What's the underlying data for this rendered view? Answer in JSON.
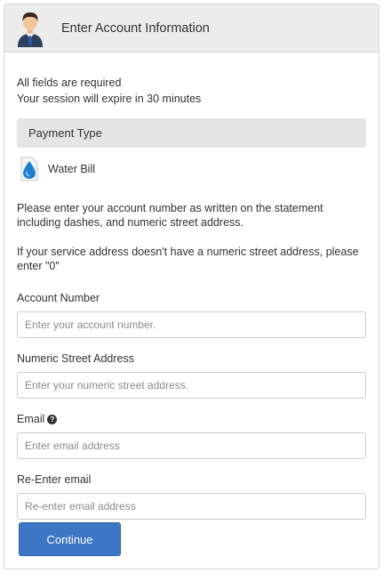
{
  "header": {
    "title": "Enter Account Information",
    "avatar_icon": "user-icon"
  },
  "notes": {
    "required": "All fields are required",
    "session": "Your session will expire in 30 minutes"
  },
  "payment": {
    "section_title": "Payment Type",
    "option_label": "Water Bill",
    "option_icon": "water-drop-icon"
  },
  "instructions": {
    "account": "Please enter your account number as written on the statement including dashes, and numeric street address.",
    "address": "If your service address doesn't have a numeric street address, please enter \"0\""
  },
  "fields": {
    "account_number": {
      "label": "Account Number",
      "placeholder": "Enter your account number.",
      "value": ""
    },
    "street_address": {
      "label": "Numeric Street Address",
      "placeholder": "Enter your numeric street address.",
      "value": ""
    },
    "email": {
      "label": "Email",
      "help_icon": "question-circle-icon",
      "placeholder": "Enter email address",
      "value": ""
    },
    "reenter_email": {
      "label": "Re-Enter email",
      "placeholder": "Re-enter email address",
      "value": ""
    }
  },
  "actions": {
    "continue_label": "Continue"
  },
  "colors": {
    "primary": "#3d76c4",
    "header_bg": "#ececec",
    "section_bg": "#e5e5e5",
    "border": "#d6d6d6"
  }
}
